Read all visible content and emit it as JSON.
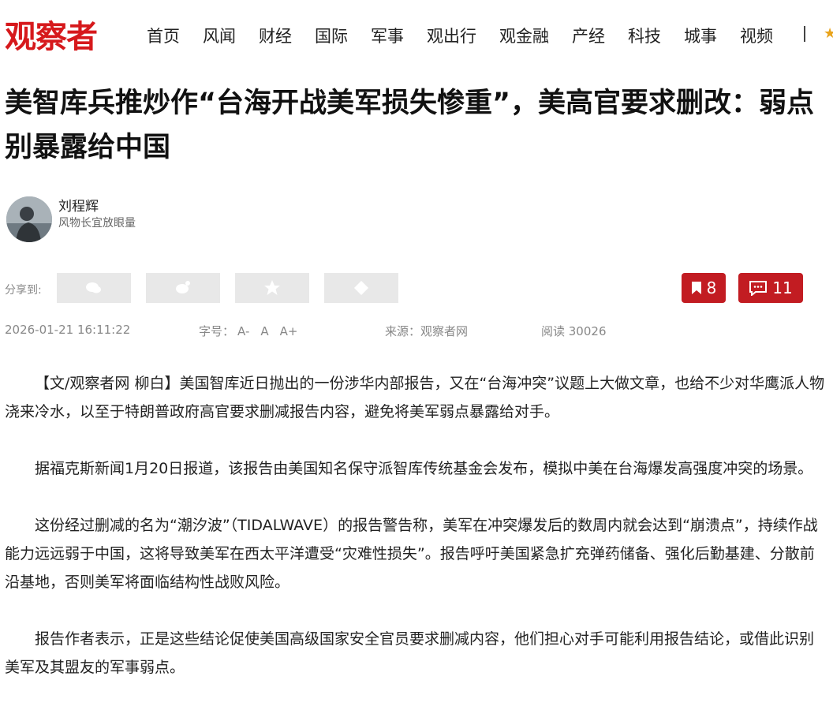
{
  "header": {
    "logo": "观察者",
    "nav": [
      "首页",
      "风闻",
      "财经",
      "国际",
      "军事",
      "观出行",
      "观金融",
      "产经",
      "科技",
      "城事",
      "视频"
    ]
  },
  "article": {
    "title": "美智库兵推炒作“台海开战美军损失惨重”，美高官要求删改：弱点别暴露给中国",
    "author": {
      "name": "刘程辉",
      "tagline": "风物长宜放眼量"
    },
    "share_label": "分享到:",
    "share_icons": [
      "wechat-icon",
      "weibo-icon",
      "qzone-icon",
      "more-share-icon"
    ],
    "bookmark_count": "8",
    "comment_count": "11",
    "meta": {
      "datetime": "2026-01-21 16:11:22",
      "font_size_label": "字号：",
      "font_smaller": "A-",
      "font_normal": "A",
      "font_larger": "A+",
      "source_label": "来源：观察者网",
      "read_label": "阅读 30026"
    },
    "paragraphs": [
      "【文/观察者网 柳白】美国智库近日抛出的一份涉华内部报告，又在“台海冲突”议题上大做文章，也给不少对华鹰派人物浇来冷水，以至于特朗普政府高官要求删减报告内容，避免将美军弱点暴露给对手。",
      "据福克斯新闻1月20日报道，该报告由美国知名保守派智库传统基金会发布，模拟中美在台海爆发高强度冲突的场景。",
      "这份经过删减的名为“潮汐波”（TIDALWAVE）的报告警告称，美军在冲突爆发后的数周内就会达到“崩溃点”，持续作战能力远远弱于中国，这将导致美军在西太平洋遭受“灾难性损失”。报告呼吁美国紧急扩充弹药储备、强化后勤基建、分散前沿基地，否则美军将面临结构性战败风险。",
      "报告作者表示，正是这些结论促使美国高级国家安全官员要求删减内容，他们担心对手可能利用报告结论，或借此识别美军及其盟友的军事弱点。"
    ]
  },
  "colors": {
    "brand": "#d6191c",
    "count_button": "#c21c22"
  }
}
